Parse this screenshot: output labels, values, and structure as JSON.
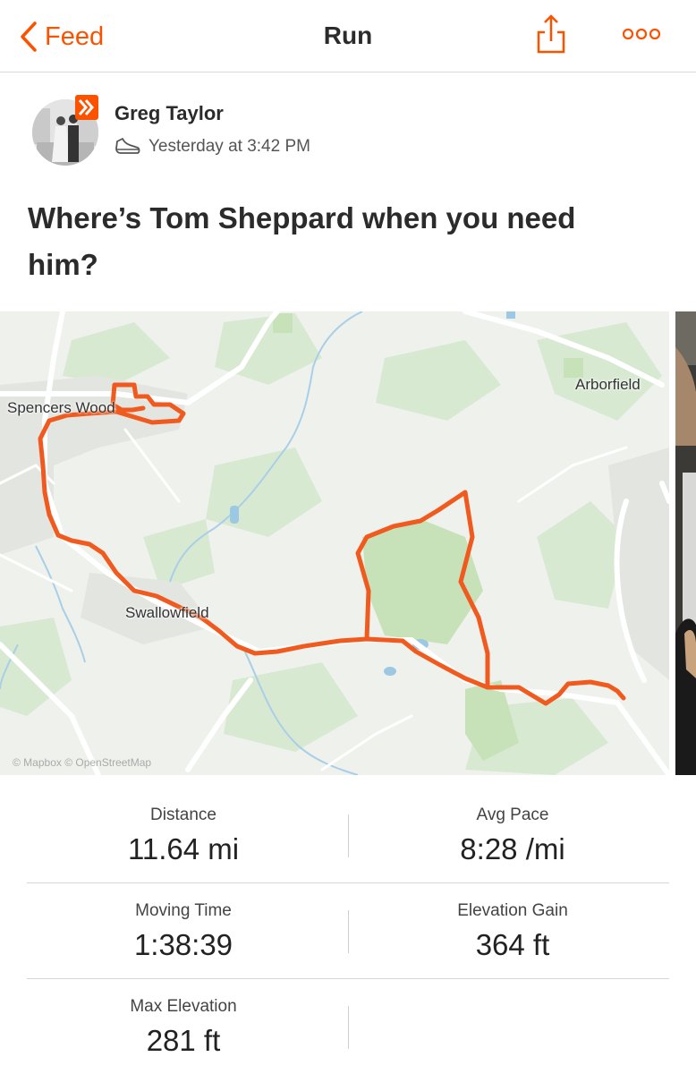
{
  "nav": {
    "back_label": "Feed",
    "title": "Run",
    "accent_color": "#fc5200"
  },
  "athlete": {
    "name": "Greg Taylor",
    "timestamp": "Yesterday at 3:42 PM",
    "activity_icon": "shoe-icon"
  },
  "activity": {
    "title": "Where’s Tom Sheppard when you need him?"
  },
  "map": {
    "labels": {
      "spencers_wood": "Spencers Wood",
      "arborfield": "Arborfield",
      "swallowfield": "Swallowfield"
    },
    "attribution": "© Mapbox © OpenStreetMap",
    "route_color": "#f05a1e"
  },
  "stats": {
    "distance": {
      "label": "Distance",
      "value": "11.64 mi"
    },
    "avg_pace": {
      "label": "Avg Pace",
      "value": "8:28 /mi"
    },
    "moving_time": {
      "label": "Moving Time",
      "value": "1:38:39"
    },
    "elevation_gain": {
      "label": "Elevation Gain",
      "value": "364 ft"
    },
    "max_elevation": {
      "label": "Max Elevation",
      "value": "281 ft"
    }
  }
}
